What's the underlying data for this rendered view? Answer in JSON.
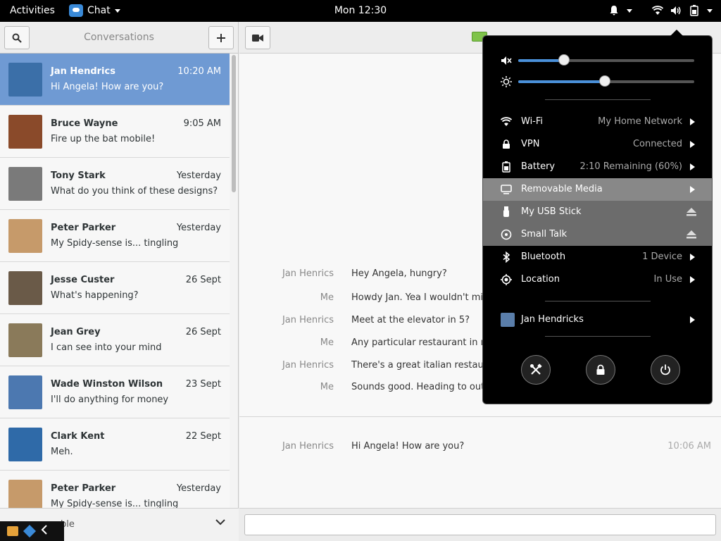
{
  "topbar": {
    "activities": "Activities",
    "app_name": "Chat",
    "clock": "Mon 12:30"
  },
  "sidebar": {
    "title": "Conversations",
    "conversations": [
      {
        "name": "Jan Hendrics",
        "time": "10:20 AM",
        "message": "Hi Angela! How are you?",
        "avatar_color": "#3b6fa8",
        "selected": true
      },
      {
        "name": "Bruce Wayne",
        "time": "9:05 AM",
        "message": "Fire up the bat mobile!",
        "avatar_color": "#8a4a2a"
      },
      {
        "name": "Tony Stark",
        "time": "Yesterday",
        "message": "What do you think of these designs?",
        "avatar_color": "#7a7a7a"
      },
      {
        "name": "Peter Parker",
        "time": "Yesterday",
        "message": "My Spidy-sense is... tingling",
        "avatar_color": "#c69a6a"
      },
      {
        "name": "Jesse Custer",
        "time": "26 Sept",
        "message": "What's happening?",
        "avatar_color": "#6a5a48"
      },
      {
        "name": "Jean Grey",
        "time": "26 Sept",
        "message": "I can see into your mind",
        "avatar_color": "#8a7a5a"
      },
      {
        "name": "Wade Winston Wilson",
        "time": "23 Sept",
        "message": "I'll do anything for money",
        "avatar_color": "#4c78b0"
      },
      {
        "name": "Clark Kent",
        "time": "22 Sept",
        "message": "Meh.",
        "avatar_color": "#2f6aa8"
      },
      {
        "name": "Peter Parker",
        "time": "Yesterday",
        "message": "My Spidy-sense is... tingling",
        "avatar_color": "#c69a6a"
      }
    ],
    "bottom_text": "ble"
  },
  "chat": {
    "messages": [
      {
        "who": "Jan Henrics",
        "text": "Hey Angela, hungry?"
      },
      {
        "who": "Me",
        "text": "Howdy Jan. Yea I wouldn't mi"
      },
      {
        "who": "Jan Henrics",
        "text": "Meet at the elevator in 5?"
      },
      {
        "who": "Me",
        "text": "Any particular restaurant in r"
      },
      {
        "who": "Jan Henrics",
        "text": "There's a great italian restaur"
      },
      {
        "who": "Me",
        "text": "Sounds good. Heading to out"
      }
    ],
    "last": {
      "who": "Jan Henrics",
      "text": "Hi Angela! How are you?",
      "time": "10:06 AM"
    },
    "input_value": ""
  },
  "status_menu": {
    "volume_level": 0.26,
    "brightness_level": 0.49,
    "items": [
      {
        "icon": "wifi-icon",
        "label": "Wi-Fi",
        "value": "My Home Network"
      },
      {
        "icon": "vpn-lock-icon",
        "label": "VPN",
        "value": "Connected"
      },
      {
        "icon": "battery-icon",
        "label": "Battery",
        "value": "2:10 Remaining (60%)"
      },
      {
        "icon": "monitor-icon",
        "label": "Removable Media",
        "value": ""
      },
      {
        "icon": "usb-icon",
        "label": "My USB Stick",
        "value": ""
      },
      {
        "icon": "disc-icon",
        "label": "Small Talk",
        "value": ""
      },
      {
        "icon": "bluetooth-icon",
        "label": "Bluetooth",
        "value": "1 Device"
      },
      {
        "icon": "location-icon",
        "label": "Location",
        "value": "In Use"
      }
    ],
    "user": "Jan Hendricks"
  }
}
